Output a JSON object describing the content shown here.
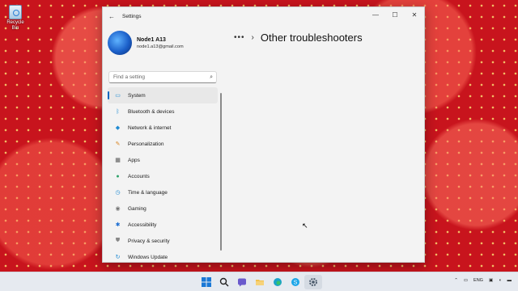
{
  "desktop": {
    "recycle_bin_label": "Recycle Bin"
  },
  "window": {
    "title": "Settings",
    "controls": [
      "minimize",
      "maximize",
      "close"
    ]
  },
  "profile": {
    "name": "Node1 A13",
    "email": "node1.a13@gmail.com"
  },
  "search": {
    "placeholder": "Find a setting",
    "icon": "search-icon"
  },
  "nav": {
    "items": [
      {
        "label": "System",
        "icon": "monitor-icon",
        "color": "#1f8ad2",
        "active": true
      },
      {
        "label": "Bluetooth & devices",
        "icon": "bluetooth-icon",
        "color": "#1f8ad2"
      },
      {
        "label": "Network & internet",
        "icon": "wifi-icon",
        "color": "#1f8ad2"
      },
      {
        "label": "Personalization",
        "icon": "brush-icon",
        "color": "#d9831f"
      },
      {
        "label": "Apps",
        "icon": "apps-icon",
        "color": "#555555"
      },
      {
        "label": "Accounts",
        "icon": "person-icon",
        "color": "#2fa36b"
      },
      {
        "label": "Time & language",
        "icon": "globe-clock-icon",
        "color": "#1f8ad2"
      },
      {
        "label": "Gaming",
        "icon": "gamepad-icon",
        "color": "#777777"
      },
      {
        "label": "Accessibility",
        "icon": "accessibility-icon",
        "color": "#1f6fd2"
      },
      {
        "label": "Privacy & security",
        "icon": "shield-icon",
        "color": "#888888"
      },
      {
        "label": "Windows Update",
        "icon": "update-icon",
        "color": "#1f8ad2"
      }
    ]
  },
  "main": {
    "breadcrumb_more": "•••",
    "page_title": "Other troubleshooters"
  },
  "taskbar": {
    "apps": [
      "windows-start-icon",
      "search-icon",
      "chat-icon",
      "file-explorer-icon",
      "edge-icon",
      "skype-icon",
      "settings-icon"
    ],
    "tray": {
      "language": "ENG"
    }
  }
}
